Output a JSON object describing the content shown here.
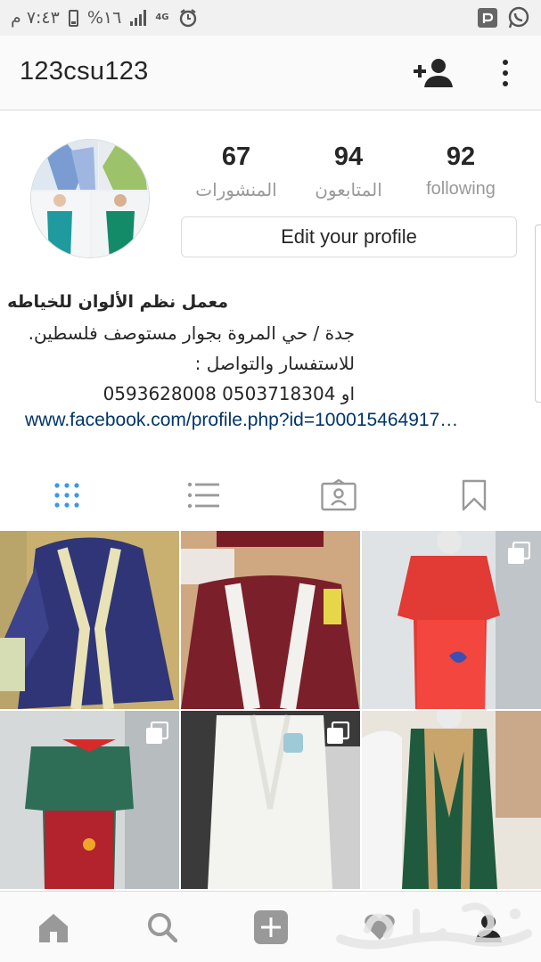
{
  "status_bar": {
    "time": "٧:٤٣ م",
    "battery": "%١٦",
    "network": "4G"
  },
  "header": {
    "username": "123csu123",
    "icons": [
      "add-user-icon",
      "more-vertical-icon"
    ]
  },
  "profile": {
    "stats": [
      {
        "count": "67",
        "label": "المنشورات"
      },
      {
        "count": "94",
        "label": "المتابعون"
      },
      {
        "count": "92",
        "label": "following"
      }
    ],
    "edit_button": "Edit your profile",
    "bio": {
      "name": "معمل نظم الألوان للخياطه",
      "line1": "جدة / حي المروة بجوار مستوصف فلسطين.",
      "line2": "للاستفسار والتواصل :",
      "line3": "0593628008 او 0503718304",
      "link": "www.facebook.com/profile.php?id=100015464917…"
    }
  },
  "tabs": [
    "grid-icon",
    "list-icon",
    "tagged-icon",
    "saved-icon"
  ],
  "grid": [
    {
      "subject": "navy robe with lace trim",
      "multi": false,
      "bg": "#3a3e8a"
    },
    {
      "subject": "maroon graduation gown with white stole",
      "multi": false,
      "bg": "#7b1f2a"
    },
    {
      "subject": "red polo shirt with apron",
      "multi": true,
      "bg": "#e23a35"
    },
    {
      "subject": "green polo shirt with maroon apron",
      "multi": true,
      "bg": "#2e6e57"
    },
    {
      "subject": "white graduation gown",
      "multi": true,
      "bg": "#f1f1f1"
    },
    {
      "subject": "green graduation gown with gold trim",
      "multi": false,
      "bg": "#1f5a3e"
    }
  ],
  "bottom_nav": [
    "home-icon",
    "search-icon",
    "add-icon",
    "activity-icon",
    "profile-icon"
  ],
  "colors": {
    "link": "#003569",
    "accent": "#3897f0",
    "muted": "#999999"
  }
}
